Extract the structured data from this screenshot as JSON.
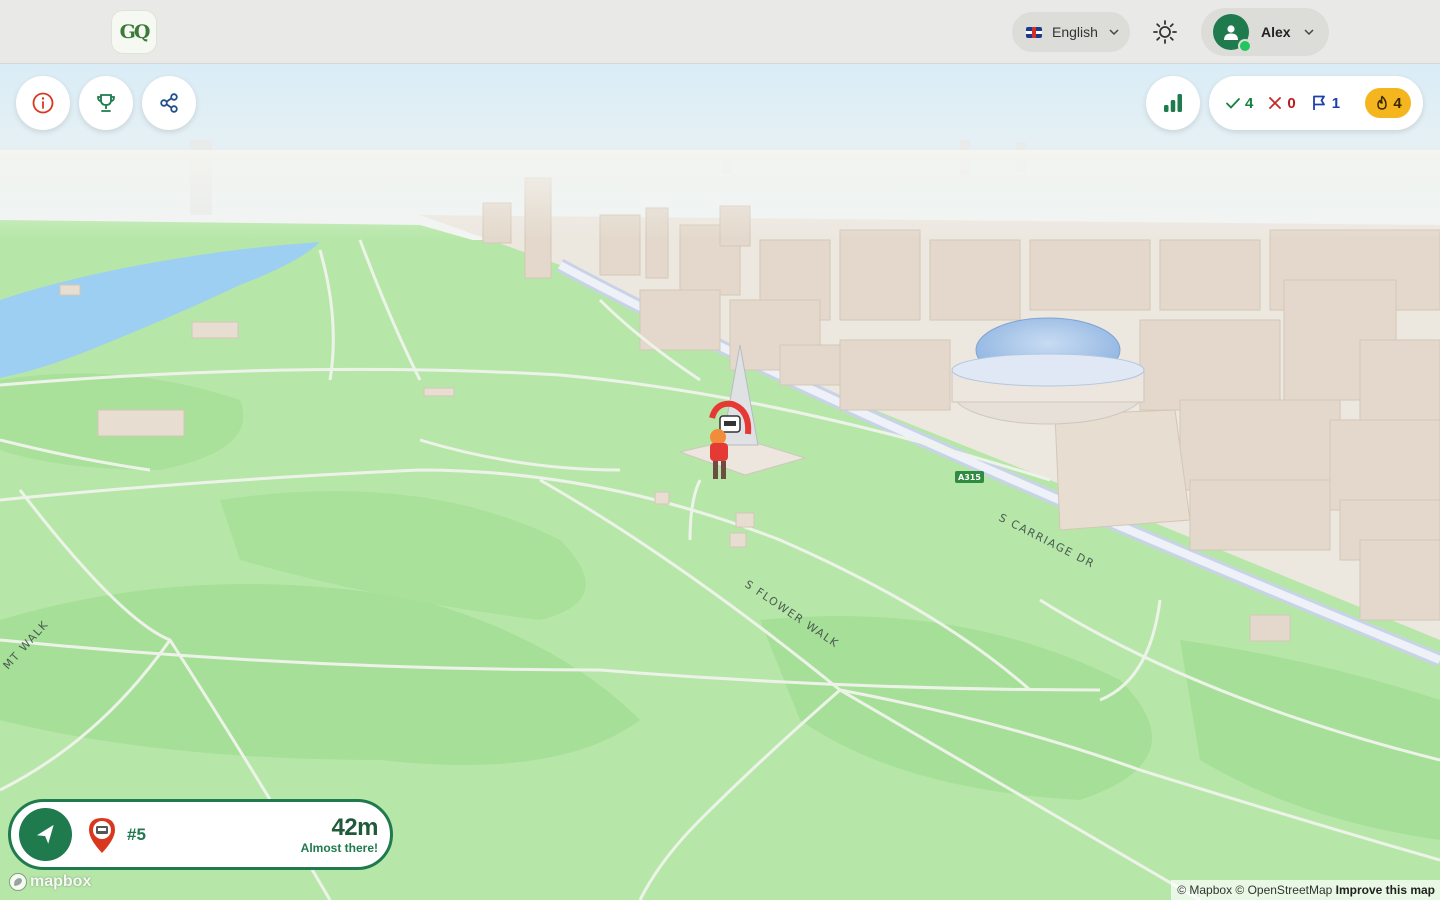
{
  "app": {
    "logo_text": "GQ"
  },
  "header": {
    "language_label": "English",
    "user_name": "Alex"
  },
  "toolbar": {
    "info_icon": "info-icon",
    "trophy_icon": "trophy-icon",
    "share_icon": "share-icon",
    "stats_icon": "bar-chart-icon"
  },
  "score": {
    "correct": "4",
    "wrong": "0",
    "flags": "1",
    "streak": "4"
  },
  "map": {
    "labels": [
      "S CARRIAGE DR",
      "S FLOWER WALK",
      "MT WALK"
    ],
    "road_shield": "A315"
  },
  "navigation": {
    "target_number": "#5",
    "distance": "42m",
    "status": "Almost there!"
  },
  "attribution": {
    "mapbox_logo": "mapbox",
    "text": "© Mapbox © OpenStreetMap",
    "improve": "Improve this map"
  },
  "colors": {
    "brand_green": "#1f7a4d",
    "park_green": "#b6e7a8",
    "streak_yellow": "#f5b51f"
  }
}
